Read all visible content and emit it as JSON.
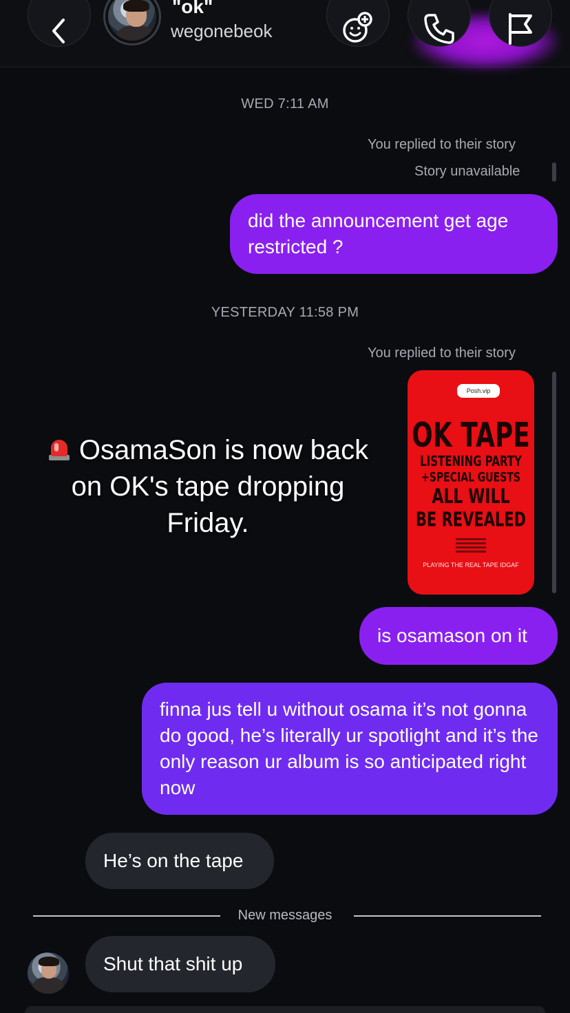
{
  "header": {
    "contact_name": "\"ok\"",
    "contact_username": "wegonebeok",
    "icons": [
      "back-chevron-icon",
      "avatar",
      "effects-icon",
      "phone-icon",
      "flag-icon"
    ]
  },
  "thread": {
    "timestamp_1": "WED 7:11 AM",
    "reply_note_1": "You replied to their story",
    "story_unavailable": "Story unavailable",
    "msg_1": "did the announcement get age restricted ?",
    "timestamp_2": "YESTERDAY 11:58 PM",
    "reply_note_2": "You replied to their story",
    "story": {
      "badge": "Posh.vip",
      "line1": "OK TAPE",
      "line2": "LISTENING PARTY",
      "line3": "+SPECIAL GUESTS",
      "line4": "ALL WILL",
      "line5": "BE REVEALED",
      "footer": "PLAYING THE REAL TAPE IDGAF",
      "background_color": "#e80f15"
    },
    "msg_2": "is osamason on it",
    "msg_3": "finna jus tell u without osama it’s not gonna do good, he’s literally ur spotlight and it’s the only reason ur album is so anticipated right now",
    "reply_1": "He’s on the tape",
    "new_messages_label": "New messages",
    "reply_2": "Shut that shit up"
  },
  "overlay_caption": {
    "line1": "OsamaSon is now back",
    "line2": "on OK's tape dropping",
    "line3": "Friday."
  },
  "colors": {
    "background": "#0b0c10",
    "sent_bubble": "#8a20f0",
    "sent_bubble_alt": "#6f2cf0",
    "received_bubble": "#23262c"
  }
}
